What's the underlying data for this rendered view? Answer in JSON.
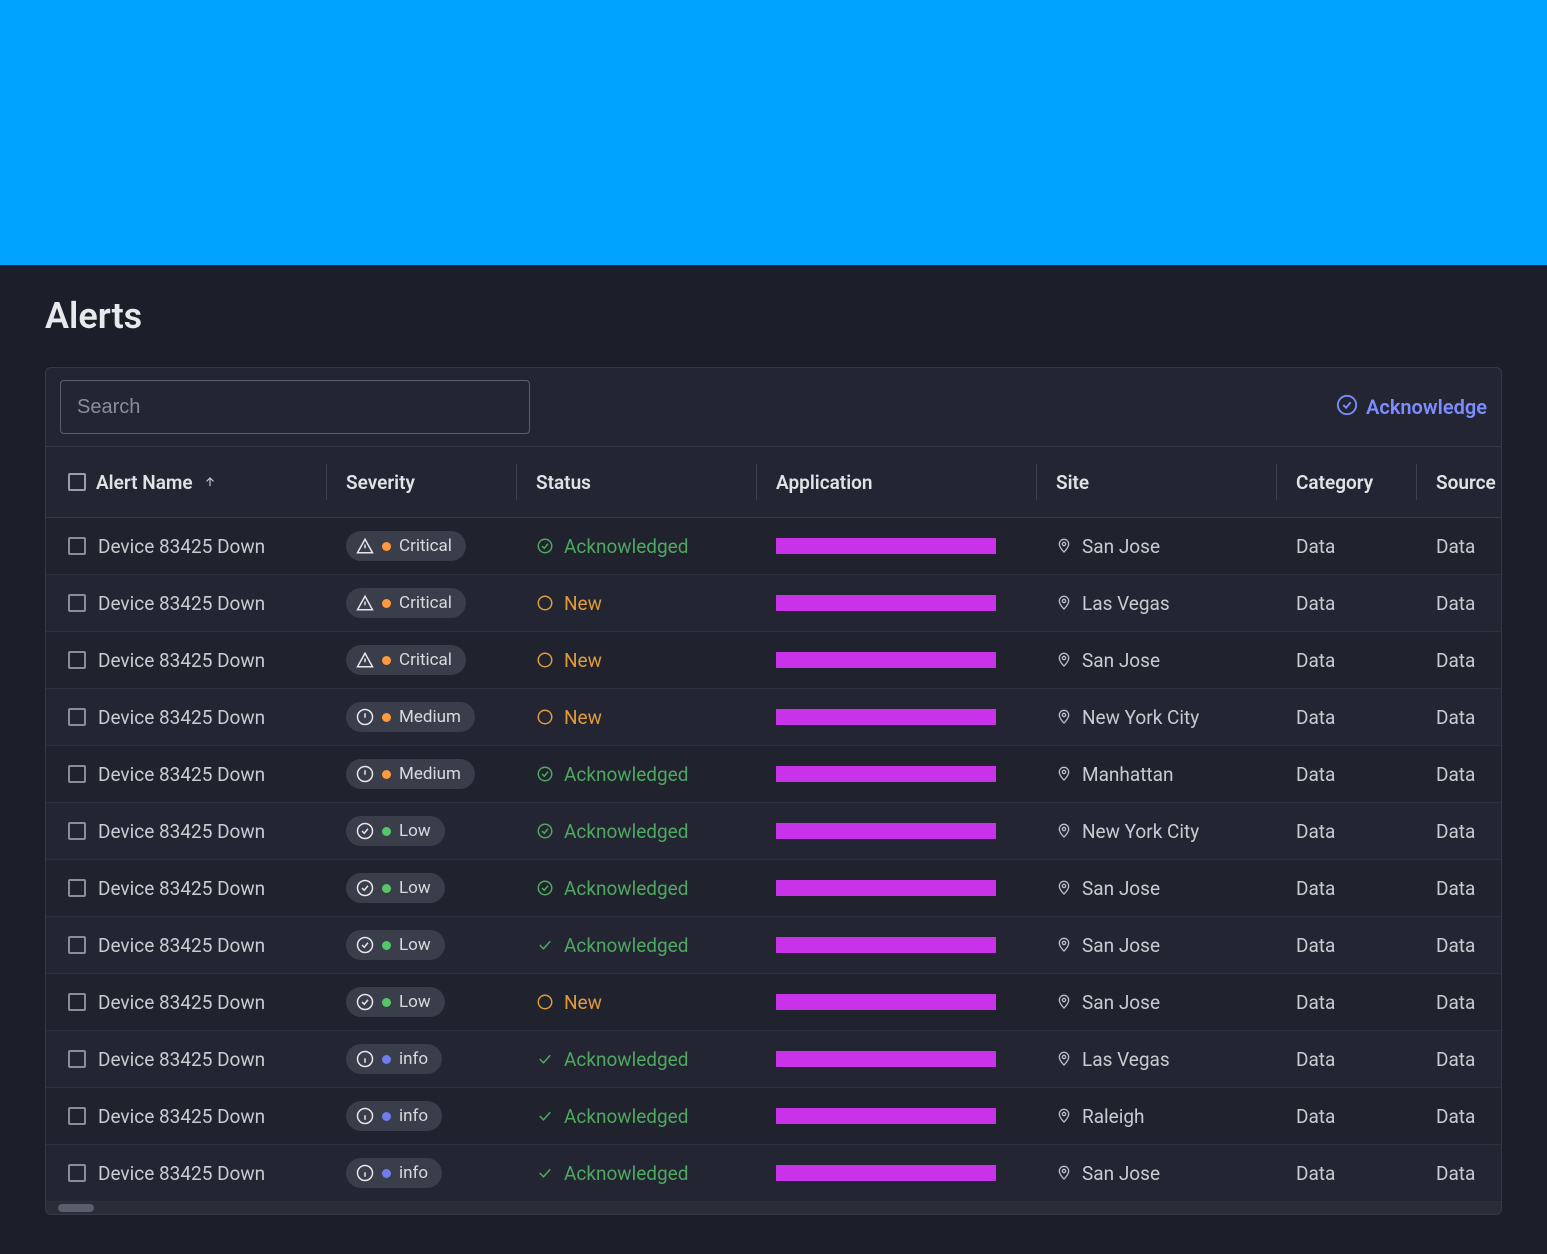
{
  "page_title": "Alerts",
  "search_placeholder": "Search",
  "acknowledge_action": "Acknowledge",
  "columns": {
    "name": "Alert Name",
    "severity": "Severity",
    "status": "Status",
    "application": "Application",
    "site": "Site",
    "category": "Category",
    "source": "Source"
  },
  "severity_labels": {
    "critical": "Critical",
    "medium": "Medium",
    "low": "Low",
    "info": "info"
  },
  "status_labels": {
    "acknowledged": "Acknowledged",
    "new": "New"
  },
  "rows": [
    {
      "name": "Device 83425 Down",
      "severity": "critical",
      "status": "acknowledged",
      "site": "San Jose",
      "category": "Data",
      "source": "Data",
      "ack_style": "circle"
    },
    {
      "name": "Device 83425 Down",
      "severity": "critical",
      "status": "new",
      "site": "Las Vegas",
      "category": "Data",
      "source": "Data"
    },
    {
      "name": "Device 83425 Down",
      "severity": "critical",
      "status": "new",
      "site": "San Jose",
      "category": "Data",
      "source": "Data"
    },
    {
      "name": "Device 83425 Down",
      "severity": "medium",
      "status": "new",
      "site": "New York City",
      "category": "Data",
      "source": "Data"
    },
    {
      "name": "Device 83425 Down",
      "severity": "medium",
      "status": "acknowledged",
      "site": "Manhattan",
      "category": "Data",
      "source": "Data",
      "ack_style": "circle"
    },
    {
      "name": "Device 83425 Down",
      "severity": "low",
      "status": "acknowledged",
      "site": "New York City",
      "category": "Data",
      "source": "Data",
      "ack_style": "circle"
    },
    {
      "name": "Device 83425 Down",
      "severity": "low",
      "status": "acknowledged",
      "site": "San Jose",
      "category": "Data",
      "source": "Data",
      "ack_style": "circle"
    },
    {
      "name": "Device 83425 Down",
      "severity": "low",
      "status": "acknowledged",
      "site": "San Jose",
      "category": "Data",
      "source": "Data",
      "ack_style": "check"
    },
    {
      "name": "Device 83425 Down",
      "severity": "low",
      "status": "new",
      "site": "San Jose",
      "category": "Data",
      "source": "Data"
    },
    {
      "name": "Device 83425 Down",
      "severity": "info",
      "status": "acknowledged",
      "site": "Las Vegas",
      "category": "Data",
      "source": "Data",
      "ack_style": "check"
    },
    {
      "name": "Device 83425 Down",
      "severity": "info",
      "status": "acknowledged",
      "site": "Raleigh",
      "category": "Data",
      "source": "Data",
      "ack_style": "check"
    },
    {
      "name": "Device 83425 Down",
      "severity": "info",
      "status": "acknowledged",
      "site": "San Jose",
      "category": "Data",
      "source": "Data",
      "ack_style": "check"
    }
  ]
}
